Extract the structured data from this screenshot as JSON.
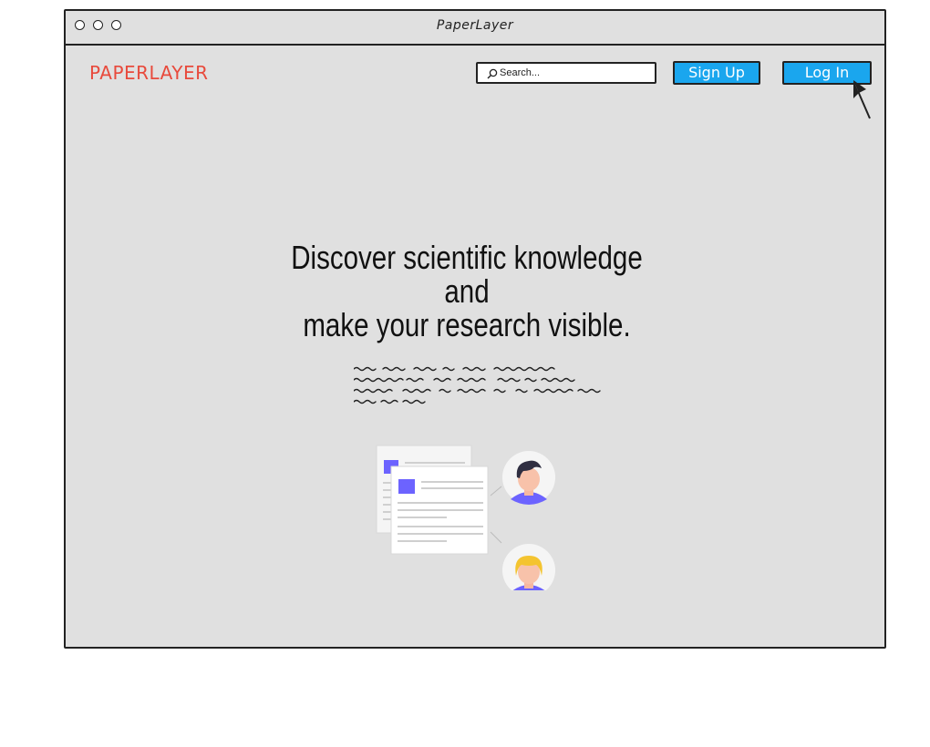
{
  "window": {
    "title": "PaperLayer"
  },
  "header": {
    "brand": "PAPERLAYER",
    "search": {
      "placeholder": "Search...",
      "value": ""
    },
    "signup_label": "Sign Up",
    "login_label": "Log In"
  },
  "hero": {
    "title_lines": [
      "Discover scientific knowledge",
      "and",
      "make your research visible."
    ]
  },
  "colors": {
    "brand": "#e84a3c",
    "button": "#1aa6ee",
    "canvas": "#e0e0e0",
    "accent": "#6c63ff",
    "avatar_hair_dark": "#2f2e41",
    "avatar_hair_blonde": "#f4c430"
  },
  "icons": {
    "search": "search-icon",
    "cursor": "mouse-pointer-icon"
  }
}
